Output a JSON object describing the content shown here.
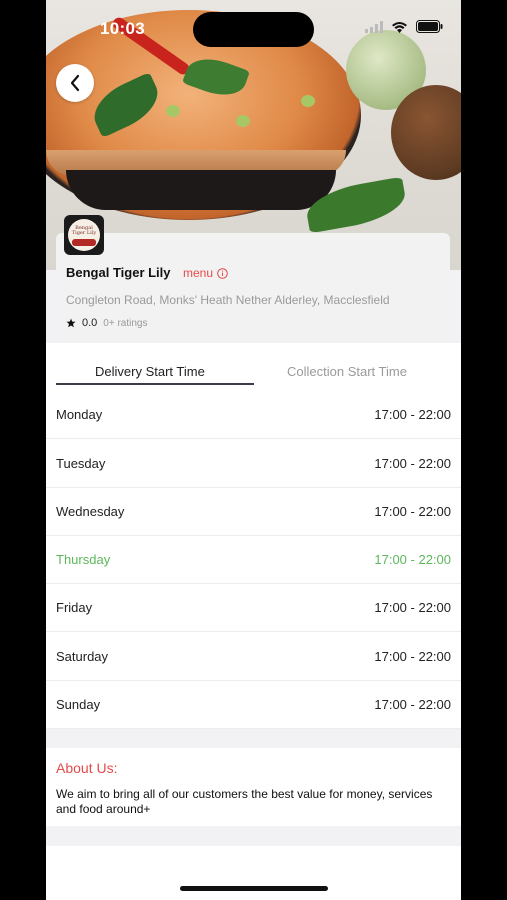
{
  "status_bar": {
    "time": "10:03"
  },
  "restaurant": {
    "name": "Bengal Tiger Lily",
    "menu_label": "menu",
    "address": "Congleton Road, Monks' Heath Nether Alderley, Macclesfield",
    "rating_value": "0.0",
    "rating_count": "0+ ratings",
    "logo_text": "Bengal Tiger Lily"
  },
  "tabs": [
    {
      "label": "Delivery Start Time",
      "active": true
    },
    {
      "label": "Collection Start Time",
      "active": false
    }
  ],
  "schedule": [
    {
      "day": "Monday",
      "hours": "17:00 - 22:00",
      "today": false
    },
    {
      "day": "Tuesday",
      "hours": "17:00 - 22:00",
      "today": false
    },
    {
      "day": "Wednesday",
      "hours": "17:00 - 22:00",
      "today": false
    },
    {
      "day": "Thursday",
      "hours": "17:00 - 22:00",
      "today": true
    },
    {
      "day": "Friday",
      "hours": "17:00 - 22:00",
      "today": false
    },
    {
      "day": "Saturday",
      "hours": "17:00 - 22:00",
      "today": false
    },
    {
      "day": "Sunday",
      "hours": "17:00 - 22:00",
      "today": false
    }
  ],
  "about": {
    "title": "About Us:",
    "text": "We aim to bring all of our customers the best value for money, services and food around+"
  },
  "colors": {
    "accent": "#e34b4b",
    "today": "#5cb85c",
    "tab_underline": "#3a3a48"
  }
}
